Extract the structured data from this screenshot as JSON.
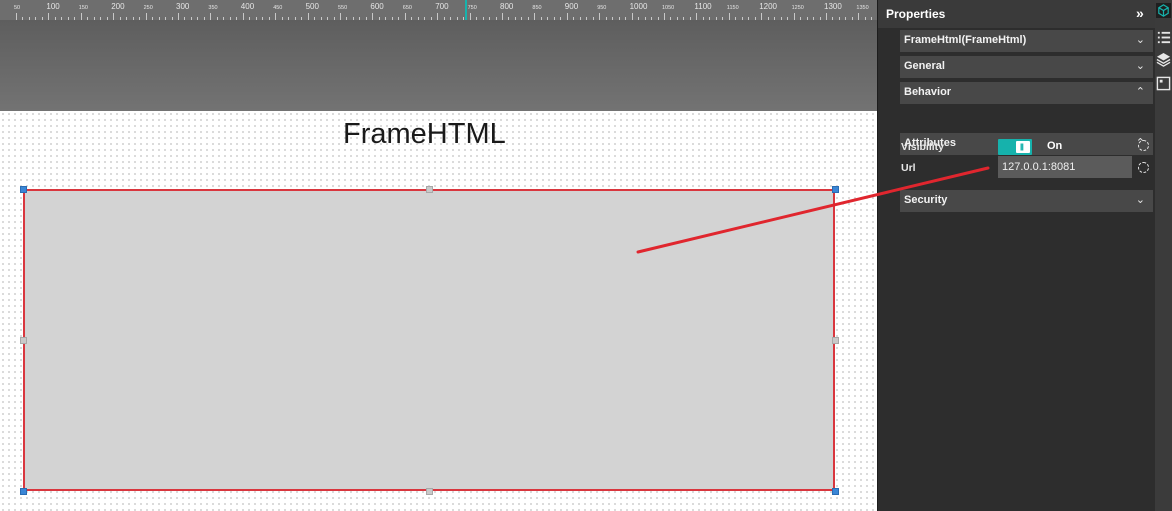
{
  "ruler": {
    "labels": [
      "50",
      "100",
      "150",
      "200",
      "250",
      "300",
      "350",
      "400",
      "450",
      "500",
      "550",
      "600",
      "650",
      "700",
      "750",
      "800",
      "850",
      "900",
      "950",
      "1000",
      "1050",
      "1100",
      "1150",
      "1200",
      "1250",
      "1300",
      "1350"
    ]
  },
  "canvas": {
    "frame_title": "FrameHTML"
  },
  "panel": {
    "title": "Properties",
    "component_select": "FrameHtml(FrameHtml)",
    "sections": {
      "general": "General",
      "behavior": "Behavior",
      "attributes": "Attributes",
      "security": "Security"
    },
    "visibility": {
      "label": "Visibility",
      "state": "On"
    },
    "url": {
      "label": "Url",
      "value": "127.0.0.1:8081"
    }
  },
  "colors": {
    "accent": "#16b2ac",
    "frame_border": "#d9363e",
    "connector_line": "#e0262e"
  },
  "icons": {
    "collapse": "double-chevron-right-icon",
    "toolbar": [
      "component-cube-icon",
      "list-tree-icon",
      "layers-icon",
      "frame-preview-icon"
    ]
  }
}
